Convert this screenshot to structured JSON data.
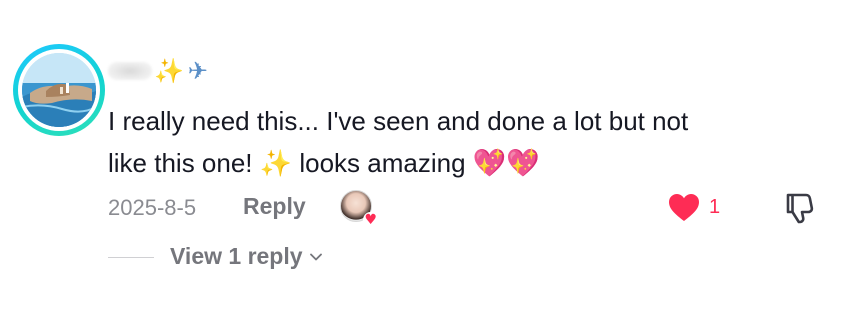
{
  "comment": {
    "username_emojis": {
      "sparkle": "✨",
      "plane": "✈"
    },
    "text_line1": "I really need this... I've seen and done a lot but not",
    "text_line2_part1": "like this one! ",
    "text_emoji_sparkle": "✨",
    "text_line2_part2": " looks amazing ",
    "text_emoji_hearts": "💖💖",
    "date": "2025-8-5",
    "reply_label": "Reply",
    "like_count": "1",
    "view_replies_label": "View 1 reply"
  },
  "colors": {
    "like_red": "#fe2c55",
    "secondary_text": "#75767c",
    "avatar_ring": "#13d4d0"
  },
  "icons": {
    "avatar": "beach-photo",
    "creator_liked": "creator-avatar-heart",
    "like": "heart-icon",
    "dislike": "thumbs-down-icon",
    "expand": "chevron-down-icon"
  }
}
